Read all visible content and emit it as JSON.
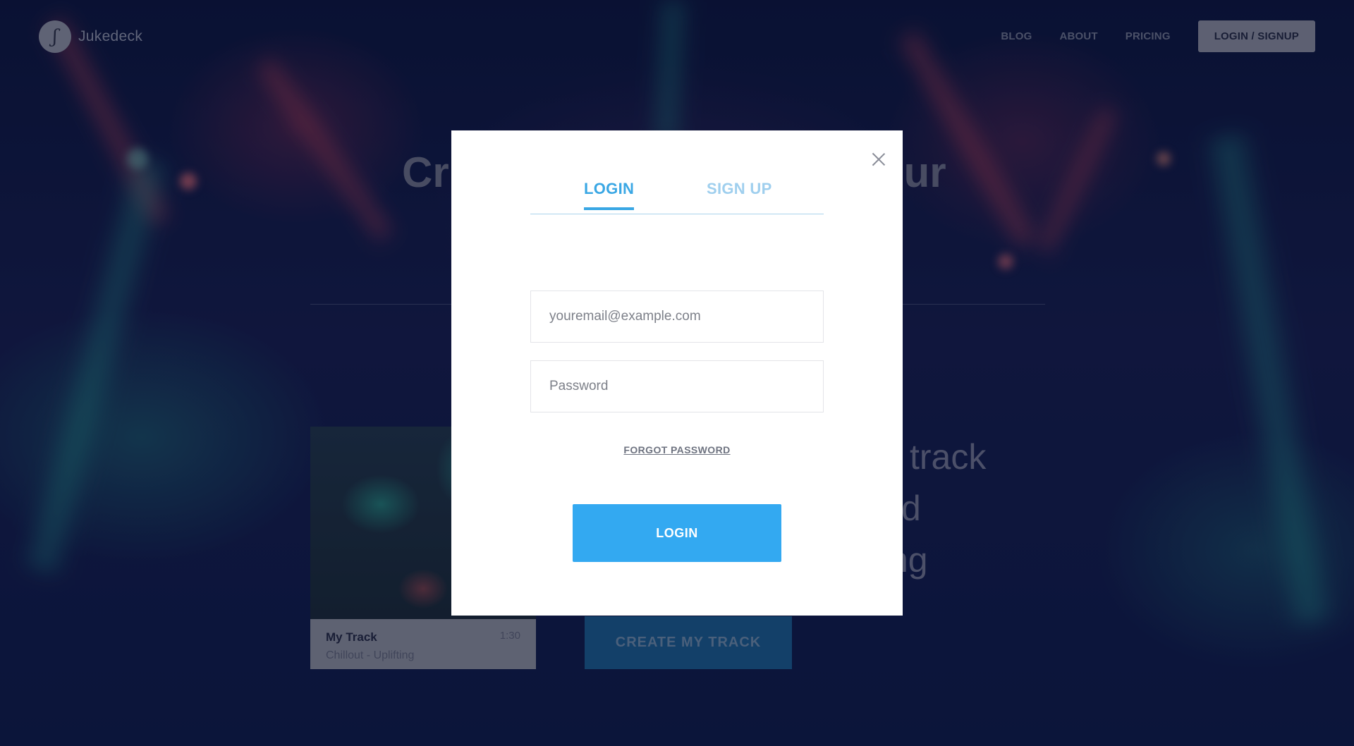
{
  "header": {
    "logo_mark": "ʃ",
    "logo_text": "Jukedeck",
    "nav": [
      {
        "label": "BLOG"
      },
      {
        "label": "ABOUT"
      },
      {
        "label": "PRICING"
      }
    ],
    "cta_label": "LOGIN / SIGNUP"
  },
  "hero": {
    "title_left": "Cr",
    "title_right": "our",
    "lines": [
      "track",
      "d",
      "ng"
    ],
    "create_button": "CREATE MY TRACK"
  },
  "track_card": {
    "name": "My Track",
    "genre": "Chillout - Uplifting",
    "duration": "1:30"
  },
  "modal": {
    "tabs": [
      {
        "label": "LOGIN",
        "active": true
      },
      {
        "label": "SIGN UP",
        "active": false
      }
    ],
    "email_placeholder": "youremail@example.com",
    "password_placeholder": "Password",
    "forgot_label": "FORGOT PASSWORD",
    "login_button": "LOGIN"
  },
  "colors": {
    "accent": "#33a9f1",
    "tab_active": "#3aa7e4",
    "tab_inactive": "#9fcfee"
  }
}
